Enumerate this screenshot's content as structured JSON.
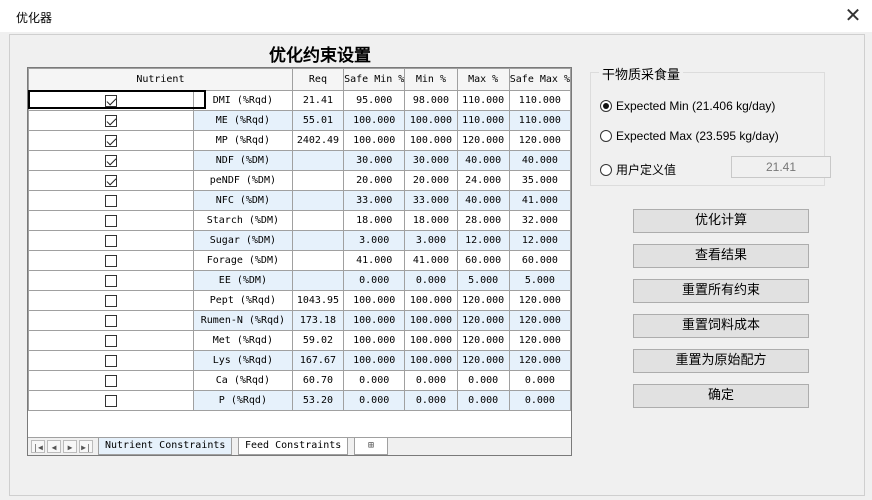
{
  "window": {
    "title": "优化器",
    "close": "✕"
  },
  "heading": "优化约束设置",
  "grid": {
    "headers": [
      "Nutrient",
      "Req",
      "Safe Min %",
      "Min %",
      "Max %",
      "Safe Max %"
    ],
    "rows": [
      {
        "checked": true,
        "name": "DMI (%Rqd)",
        "req": "21.41",
        "safe_min": "95.000",
        "min": "98.000",
        "max": "110.000",
        "safe_max": "110.000"
      },
      {
        "checked": true,
        "name": "ME (%Rqd)",
        "req": "55.01",
        "safe_min": "100.000",
        "min": "100.000",
        "max": "110.000",
        "safe_max": "110.000"
      },
      {
        "checked": true,
        "name": "MP (%Rqd)",
        "req": "2402.49",
        "safe_min": "100.000",
        "min": "100.000",
        "max": "120.000",
        "safe_max": "120.000"
      },
      {
        "checked": true,
        "name": "NDF (%DM)",
        "req": "",
        "safe_min": "30.000",
        "min": "30.000",
        "max": "40.000",
        "safe_max": "40.000"
      },
      {
        "checked": true,
        "name": "peNDF (%DM)",
        "req": "",
        "safe_min": "20.000",
        "min": "20.000",
        "max": "24.000",
        "safe_max": "35.000"
      },
      {
        "checked": false,
        "name": "NFC (%DM)",
        "req": "",
        "safe_min": "33.000",
        "min": "33.000",
        "max": "40.000",
        "safe_max": "41.000"
      },
      {
        "checked": false,
        "name": "Starch (%DM)",
        "req": "",
        "safe_min": "18.000",
        "min": "18.000",
        "max": "28.000",
        "safe_max": "32.000"
      },
      {
        "checked": false,
        "name": "Sugar (%DM)",
        "req": "",
        "safe_min": "3.000",
        "min": "3.000",
        "max": "12.000",
        "safe_max": "12.000"
      },
      {
        "checked": false,
        "name": "Forage (%DM)",
        "req": "",
        "safe_min": "41.000",
        "min": "41.000",
        "max": "60.000",
        "safe_max": "60.000"
      },
      {
        "checked": false,
        "name": "EE (%DM)",
        "req": "",
        "safe_min": "0.000",
        "min": "0.000",
        "max": "5.000",
        "safe_max": "5.000"
      },
      {
        "checked": false,
        "name": "Pept (%Rqd)",
        "req": "1043.95",
        "safe_min": "100.000",
        "min": "100.000",
        "max": "120.000",
        "safe_max": "120.000"
      },
      {
        "checked": false,
        "name": "Rumen-N (%Rqd)",
        "req": "173.18",
        "safe_min": "100.000",
        "min": "100.000",
        "max": "120.000",
        "safe_max": "120.000"
      },
      {
        "checked": false,
        "name": "Met (%Rqd)",
        "req": "59.02",
        "safe_min": "100.000",
        "min": "100.000",
        "max": "120.000",
        "safe_max": "120.000"
      },
      {
        "checked": false,
        "name": "Lys (%Rqd)",
        "req": "167.67",
        "safe_min": "100.000",
        "min": "100.000",
        "max": "120.000",
        "safe_max": "120.000"
      },
      {
        "checked": false,
        "name": "Ca (%Rqd)",
        "req": "60.70",
        "safe_min": "0.000",
        "min": "0.000",
        "max": "0.000",
        "safe_max": "0.000"
      },
      {
        "checked": false,
        "name": "P (%Rqd)",
        "req": "53.20",
        "safe_min": "0.000",
        "min": "0.000",
        "max": "0.000",
        "safe_max": "0.000"
      }
    ]
  },
  "tabs": {
    "nav": [
      "|◀",
      "◀",
      "▶",
      "▶|"
    ],
    "sheets": [
      "Nutrient Constraints",
      "Feed Constraints"
    ],
    "add_icon": "⊞"
  },
  "dmi_group": {
    "title": "干物质采食量",
    "options": [
      "Expected Min (21.406 kg/day)",
      "Expected Max (23.595 kg/day)",
      "用户定义值"
    ],
    "selected_index": 0,
    "custom_value": "21.41"
  },
  "buttons": [
    "优化计算",
    "查看结果",
    "重置所有约束",
    "重置饲料成本",
    "重置为原始配方",
    "确定"
  ]
}
